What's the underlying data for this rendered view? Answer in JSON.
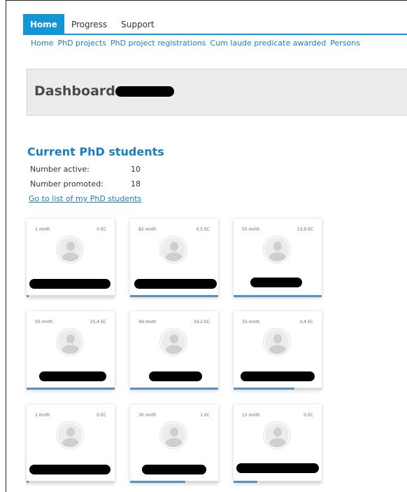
{
  "nav": {
    "tabs": [
      {
        "label": "Home",
        "active": true
      },
      {
        "label": "Progress",
        "active": false
      },
      {
        "label": "Support",
        "active": false
      }
    ],
    "subnav": [
      "Home",
      "PhD projects",
      "PhD project registrations",
      "Cum laude predicate awarded",
      "Persons"
    ]
  },
  "dashboard": {
    "title": "Dashboard"
  },
  "section": {
    "title": "Current PhD students",
    "active_label": "Number active:",
    "active_value": "10",
    "promoted_label": "Number promoted:",
    "promoted_value": "18",
    "link": "Go to list of my PhD students"
  },
  "colors": {
    "accent": "#1396d8",
    "link": "#1a7fc0",
    "progress": "#5b8fc7"
  },
  "students": [
    {
      "months": "1 mnth",
      "ec": "0 EC",
      "progress": 0.02
    },
    {
      "months": "82 mnth",
      "ec": "0,5 EC",
      "progress": 1.0
    },
    {
      "months": "55 mnth",
      "ec": "13,9 EC",
      "progress": 1.0
    },
    {
      "months": "50 mnth",
      "ec": "25,4 EC",
      "progress": 1.0
    },
    {
      "months": "49 mnth",
      "ec": "34,2 EC",
      "progress": 1.0
    },
    {
      "months": "33 mnth",
      "ec": "4,4 EC",
      "progress": 0.69
    },
    {
      "months": "1 mnth",
      "ec": "0 EC",
      "progress": 0.02
    },
    {
      "months": "30 mnth",
      "ec": "1 EC",
      "progress": 0.63
    },
    {
      "months": "13 mnth",
      "ec": "0 EC",
      "progress": 0.27
    }
  ]
}
